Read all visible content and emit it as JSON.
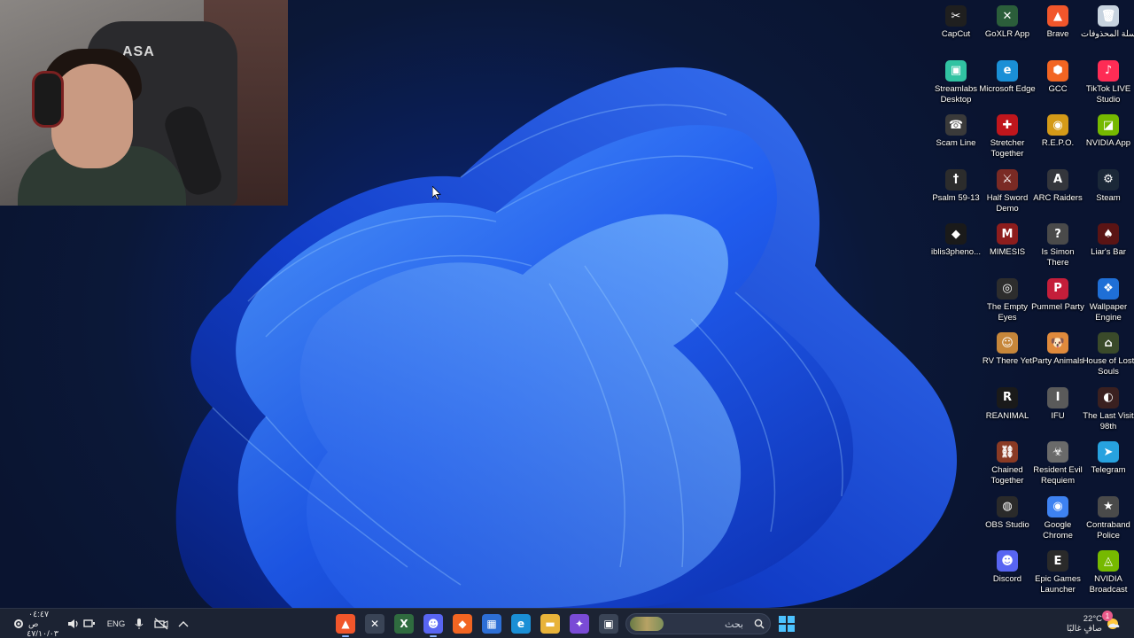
{
  "webcam": {
    "chair_logo": "ASA"
  },
  "desktop_icons": [
    {
      "label": "CapCut",
      "icon": "capcut-icon",
      "color": "#1f1f1f",
      "glyph": "✂"
    },
    {
      "label": "GoXLR App",
      "icon": "goxlr-icon",
      "color": "#2b5e3a",
      "glyph": "✕"
    },
    {
      "label": "Brave",
      "icon": "brave-icon",
      "color": "#f1562b",
      "glyph": "▲"
    },
    {
      "label": "سلة المحذوفات",
      "icon": "recycle-bin-icon",
      "color": "#c7d3df",
      "glyph": "🗑"
    },
    {
      "label": "Streamlabs Desktop",
      "icon": "streamlabs-icon",
      "color": "#31c3a2",
      "glyph": "▣"
    },
    {
      "label": "Microsoft Edge",
      "icon": "edge-icon",
      "color": "#1a8fd6",
      "glyph": "e"
    },
    {
      "label": "GCC",
      "icon": "gcc-icon",
      "color": "#f26522",
      "glyph": "⬢"
    },
    {
      "label": "TikTok LIVE Studio",
      "icon": "tiktok-icon",
      "color": "#fe2c55",
      "glyph": "♪"
    },
    {
      "label": "Scam Line",
      "icon": "scam-line-icon",
      "color": "#3a3a3a",
      "glyph": "☎"
    },
    {
      "label": "Stretcher Together",
      "icon": "stretcher-icon",
      "color": "#c0161c",
      "glyph": "✚"
    },
    {
      "label": "R.E.P.O.",
      "icon": "repo-icon",
      "color": "#d49a18",
      "glyph": "◉"
    },
    {
      "label": "NVIDIA App",
      "icon": "nvidia-icon",
      "color": "#76b900",
      "glyph": "◪"
    },
    {
      "label": "Psalm 59-13",
      "icon": "psalm-icon",
      "color": "#2c2c2c",
      "glyph": "†"
    },
    {
      "label": "Half Sword Demo",
      "icon": "half-sword-icon",
      "color": "#7a2a24",
      "glyph": "⚔"
    },
    {
      "label": "ARC Raiders",
      "icon": "arc-raiders-icon",
      "color": "#34363c",
      "glyph": "A"
    },
    {
      "label": "Steam",
      "icon": "steam-icon",
      "color": "#1b2838",
      "glyph": "⚙"
    },
    {
      "label": "iblis3pheno...",
      "icon": "iblis-icon",
      "color": "#1a1a1a",
      "glyph": "◆"
    },
    {
      "label": "MIMESIS",
      "icon": "mimesis-icon",
      "color": "#8d1d1d",
      "glyph": "M"
    },
    {
      "label": "Is Simon There",
      "icon": "simon-icon",
      "color": "#4a4a4a",
      "glyph": "?"
    },
    {
      "label": "Liar's Bar",
      "icon": "liars-bar-icon",
      "color": "#5a1414",
      "glyph": "♠"
    },
    {
      "label": "The Empty Eyes",
      "icon": "empty-eyes-icon",
      "color": "#2d2d2d",
      "glyph": "◎"
    },
    {
      "label": "Pummel Party",
      "icon": "pummel-party-icon",
      "color": "#c41e3a",
      "glyph": "P"
    },
    {
      "label": "Wallpaper Engine",
      "icon": "wallpaper-engine-icon",
      "color": "#1f6fd6",
      "glyph": "❖"
    },
    {
      "label": "RV There Yet",
      "icon": "rv-there-yet-icon",
      "color": "#c6863a",
      "glyph": "☺"
    },
    {
      "label": "Party Animals",
      "icon": "party-animals-icon",
      "color": "#e08a3c",
      "glyph": "🐶"
    },
    {
      "label": "House of Lost Souls",
      "icon": "house-lost-souls-icon",
      "color": "#3a4a2a",
      "glyph": "⌂"
    },
    {
      "label": "REANIMAL",
      "icon": "reanimal-icon",
      "color": "#1a1a1a",
      "glyph": "R"
    },
    {
      "label": "IFU",
      "icon": "ifu-icon",
      "color": "#5a5a5a",
      "glyph": "I"
    },
    {
      "label": "The Last Visit 98th",
      "icon": "last-visit-icon",
      "color": "#3a2020",
      "glyph": "◐"
    },
    {
      "label": "Chained Together",
      "icon": "chained-together-icon",
      "color": "#8a3a24",
      "glyph": "⛓"
    },
    {
      "label": "Resident Evil Requiem",
      "icon": "resident-evil-icon",
      "color": "#6a6a6a",
      "glyph": "☣"
    },
    {
      "label": "Telegram",
      "icon": "telegram-icon",
      "color": "#27a2df",
      "glyph": "➤"
    },
    {
      "label": "OBS Studio",
      "icon": "obs-icon",
      "color": "#2a2a2a",
      "glyph": "◍"
    },
    {
      "label": "Google Chrome",
      "icon": "chrome-icon",
      "color": "#3e82f1",
      "glyph": "◉"
    },
    {
      "label": "Contraband Police",
      "icon": "contraband-police-icon",
      "color": "#4a4a4a",
      "glyph": "★"
    },
    {
      "label": "Discord",
      "icon": "discord-icon",
      "color": "#5865f2",
      "glyph": "☻"
    },
    {
      "label": "Epic Games Launcher",
      "icon": "epic-games-icon",
      "color": "#2a2a2a",
      "glyph": "E"
    },
    {
      "label": "NVIDIA Broadcast",
      "icon": "nvidia-broadcast-icon",
      "color": "#76b900",
      "glyph": "◬"
    }
  ],
  "taskbar": {
    "time": "٠٤:٤٧ ص",
    "date": "٤٧/١٠/٠٣",
    "language": "ENG",
    "search_placeholder": "بحث",
    "weather_temp": "22°C",
    "weather_desc": "صافٍ غالبًا",
    "notification_badge": "1",
    "pinned": [
      {
        "icon": "brave-taskbar-icon",
        "color": "#f1562b",
        "glyph": "▲",
        "active": true
      },
      {
        "icon": "goxlr-taskbar-icon",
        "color": "#3a4456",
        "glyph": "✕",
        "active": false
      },
      {
        "icon": "excel-taskbar-icon",
        "color": "#2f6b3f",
        "glyph": "X",
        "active": false
      },
      {
        "icon": "discord-taskbar-icon",
        "color": "#5865f2",
        "glyph": "☻",
        "active": true
      },
      {
        "icon": "app-orange-taskbar-icon",
        "color": "#f26522",
        "glyph": "◆",
        "active": false
      },
      {
        "icon": "store-taskbar-icon",
        "color": "#2d6fd6",
        "glyph": "▦",
        "active": false
      },
      {
        "icon": "edge-taskbar-icon",
        "color": "#1a8fd6",
        "glyph": "e",
        "active": false
      },
      {
        "icon": "file-explorer-taskbar-icon",
        "color": "#e8b33a",
        "glyph": "▬",
        "active": false
      },
      {
        "icon": "copilot-taskbar-icon",
        "color": "#7a4bd6",
        "glyph": "✦",
        "active": false
      },
      {
        "icon": "task-view-taskbar-icon",
        "color": "#3a4456",
        "glyph": "▣",
        "active": false
      }
    ]
  }
}
